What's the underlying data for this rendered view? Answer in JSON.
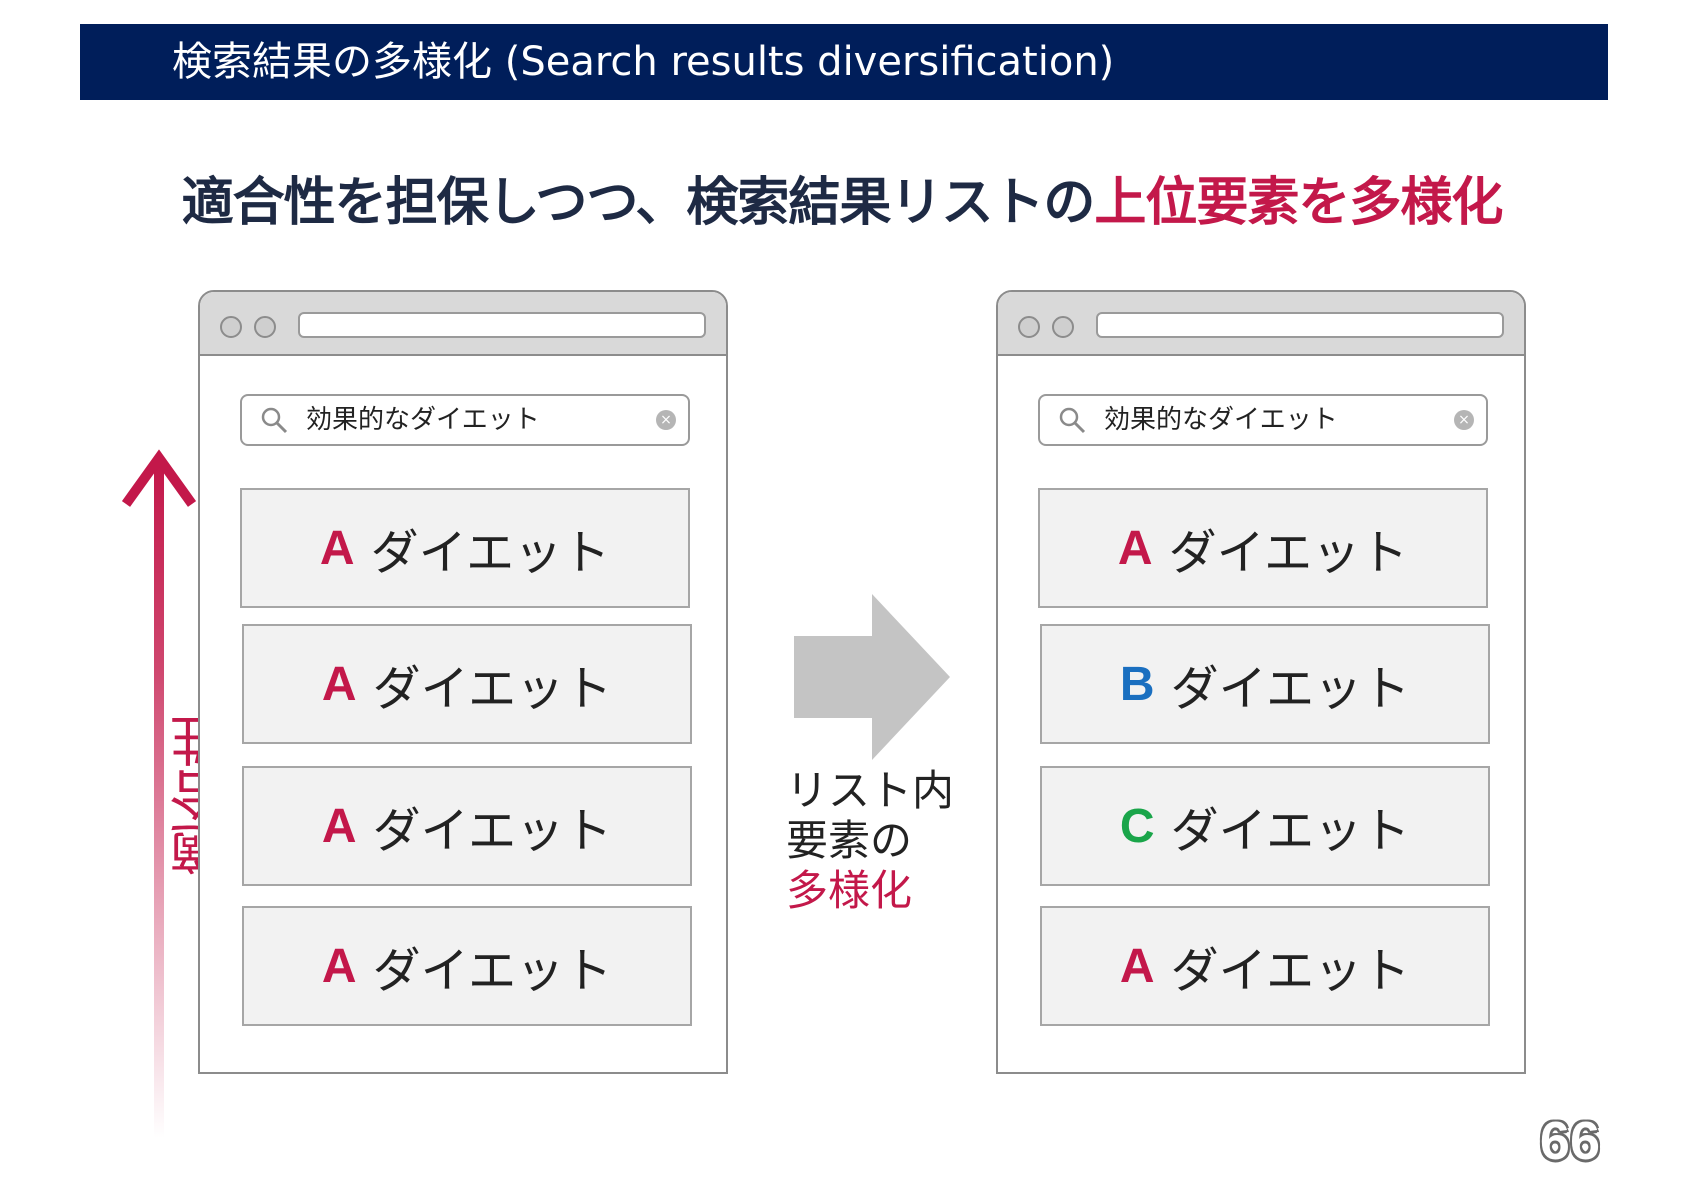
{
  "header": {
    "title": "検索結果の多様化 (Search results diversification)"
  },
  "headline": {
    "text_main": "適合性を担保しつつ、検索結果リストの",
    "text_accent": "上位要素を多様化"
  },
  "axis": {
    "label": "適合性"
  },
  "transition": {
    "line1": "リスト内",
    "line2": "要素の",
    "line3_accent": "多様化"
  },
  "left_browser": {
    "search_query": "効果的なダイエット",
    "results": [
      {
        "letter": "A",
        "label": "ダイエット"
      },
      {
        "letter": "A",
        "label": "ダイエット"
      },
      {
        "letter": "A",
        "label": "ダイエット"
      },
      {
        "letter": "A",
        "label": "ダイエット"
      }
    ]
  },
  "right_browser": {
    "search_query": "効果的なダイエット",
    "results": [
      {
        "letter": "A",
        "label": "ダイエット"
      },
      {
        "letter": "B",
        "label": "ダイエット"
      },
      {
        "letter": "C",
        "label": "ダイエット"
      },
      {
        "letter": "A",
        "label": "ダイエット"
      }
    ]
  },
  "colors": {
    "accent": "#c3184a",
    "A": "#c3184a",
    "B": "#1a6fc0",
    "C": "#1aa54a",
    "header_bg": "#001e5a"
  },
  "page_number": "66"
}
